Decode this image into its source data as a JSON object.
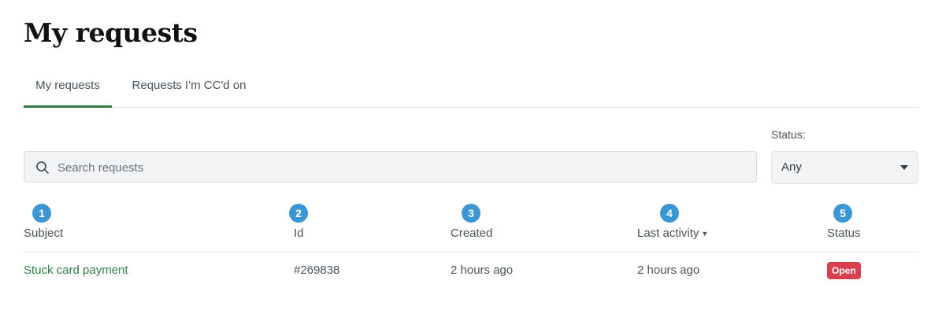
{
  "page": {
    "title": "My requests"
  },
  "tabs": [
    {
      "label": "My requests",
      "active": true
    },
    {
      "label": "Requests I'm CC'd on",
      "active": false
    }
  ],
  "filters": {
    "status_label": "Status:",
    "status_value": "Any",
    "search_placeholder": "Search requests",
    "search_value": ""
  },
  "table": {
    "columns": [
      {
        "marker": "1",
        "label": "Subject"
      },
      {
        "marker": "2",
        "label": "Id"
      },
      {
        "marker": "3",
        "label": "Created"
      },
      {
        "marker": "4",
        "label": "Last activity",
        "sorted": "desc"
      },
      {
        "marker": "5",
        "label": "Status"
      }
    ],
    "rows": [
      {
        "subject": "Stuck card payment",
        "id": "#269838",
        "created": "2 hours ago",
        "last_activity": "2 hours ago",
        "status": "Open"
      }
    ]
  },
  "colors": {
    "accent": "#2f7d45",
    "status_open": "#d93f4c",
    "marker": "#3d96d4"
  },
  "icons": {
    "search": "search-icon",
    "dropdown": "caret-down-icon",
    "sort": "sort-desc-icon"
  }
}
